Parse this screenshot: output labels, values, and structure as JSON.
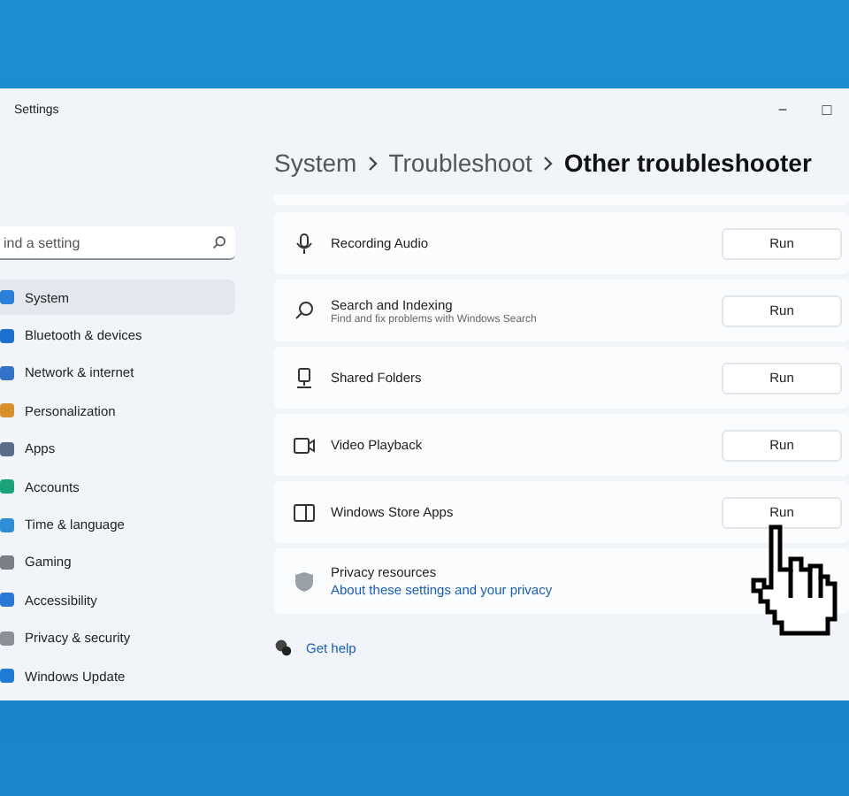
{
  "window": {
    "title": "Settings",
    "controls": [
      "−",
      "□"
    ]
  },
  "search": {
    "placeholder": "ind a setting"
  },
  "sidebar": {
    "items": [
      {
        "label": "System",
        "selected": true
      },
      {
        "label": "Bluetooth & devices",
        "selected": false
      },
      {
        "label": "Network & internet",
        "selected": false
      },
      {
        "label": "Personalization",
        "selected": false
      },
      {
        "label": "Apps",
        "selected": false
      },
      {
        "label": "Accounts",
        "selected": false
      },
      {
        "label": "Time & language",
        "selected": false
      },
      {
        "label": "Gaming",
        "selected": false
      },
      {
        "label": "Accessibility",
        "selected": false
      },
      {
        "label": "Privacy & security",
        "selected": false
      },
      {
        "label": "Windows Update",
        "selected": false
      }
    ]
  },
  "breadcrumb": [
    "System",
    "Troubleshoot",
    "Other troubleshooter"
  ],
  "troubleshooters": [
    {
      "kind": "mic",
      "title": "Recording Audio",
      "button": "Run"
    },
    {
      "kind": "search",
      "title": "Search and Indexing",
      "description": "Find and fix problems with Windows Search",
      "button": "Run"
    },
    {
      "kind": "folder",
      "title": "Shared Folders",
      "button": "Run"
    },
    {
      "kind": "video",
      "title": "Video Playback",
      "button": "Run"
    },
    {
      "kind": "store",
      "title": "Windows Store Apps",
      "button": "Run"
    }
  ],
  "privacy": {
    "title": "Privacy resources",
    "link": "About these settings and your privacy"
  },
  "help": {
    "link": "Get help"
  }
}
